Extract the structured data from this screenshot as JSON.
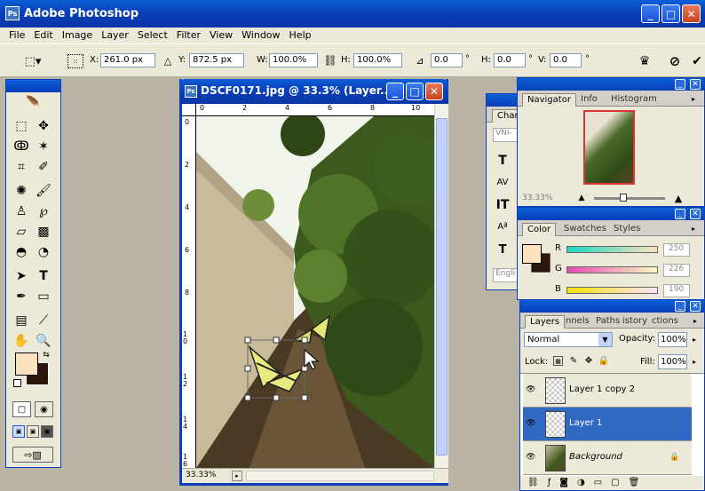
{
  "app": {
    "title": "Adobe Photoshop"
  },
  "menu": [
    "File",
    "Edit",
    "Image",
    "Layer",
    "Select",
    "Filter",
    "View",
    "Window",
    "Help"
  ],
  "options": {
    "x_label": "X:",
    "x_value": "261.0 px",
    "y_label": "Y:",
    "y_value": "872.5 px",
    "w_label": "W:",
    "w_value": "100.0%",
    "h_label": "H:",
    "h_value": "100.0%",
    "angle_value": "0.0",
    "deg": "°",
    "hskew_label": "H:",
    "hskew_value": "0.0",
    "vskew_label": "V:",
    "vskew_value": "0.0"
  },
  "document": {
    "title": "DSCF0171.jpg @ 33.3% (Layer...",
    "zoom": "33.33%",
    "ruler_top": [
      "0",
      "2",
      "4",
      "6",
      "8",
      "10"
    ],
    "ruler_left": [
      "0",
      "2",
      "4",
      "6",
      "8",
      "10",
      "12",
      "14",
      "16"
    ]
  },
  "character_panel": {
    "tab": "Char",
    "font": "VNI-",
    "lang": "Engli"
  },
  "navigator": {
    "tabs": [
      "Navigator",
      "Info",
      "Histogram"
    ],
    "zoom": "33.33%"
  },
  "color": {
    "tabs": [
      "Color",
      "Swatches",
      "Styles"
    ],
    "r_label": "R",
    "r_value": "250",
    "g_label": "G",
    "g_value": "226",
    "b_label": "B",
    "b_value": "190",
    "foreground": "#fae2be",
    "background": "#2b150d"
  },
  "layers": {
    "tabs": [
      "Layers",
      "nnels",
      "Paths",
      "istory",
      "ctions"
    ],
    "blend_mode": "Normal",
    "opacity_label": "Opacity:",
    "opacity_value": "100%",
    "lock_label": "Lock:",
    "fill_label": "Fill:",
    "fill_value": "100%",
    "items": [
      {
        "name": "Layer 1 copy 2"
      },
      {
        "name": "Layer 1"
      },
      {
        "name": "Background"
      }
    ]
  },
  "accent": "#0a3fb8",
  "selected_layer_color": "#316ac5"
}
